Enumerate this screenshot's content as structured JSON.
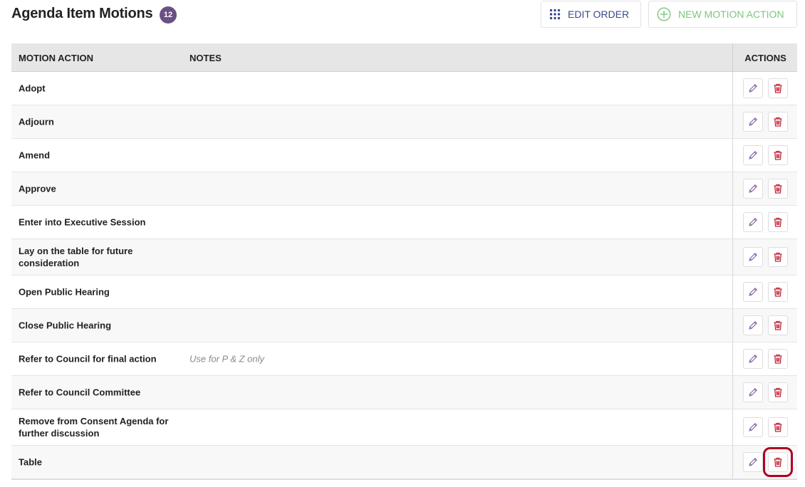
{
  "header": {
    "title": "Agenda Item Motions",
    "count": "12",
    "edit_order_label": "EDIT ORDER",
    "new_motion_label": "NEW MOTION ACTION"
  },
  "table": {
    "columns": {
      "motion_action": "MOTION ACTION",
      "notes": "NOTES",
      "actions": "ACTIONS"
    },
    "rows": [
      {
        "motion": "Adopt",
        "notes": ""
      },
      {
        "motion": "Adjourn",
        "notes": ""
      },
      {
        "motion": "Amend",
        "notes": ""
      },
      {
        "motion": "Approve",
        "notes": ""
      },
      {
        "motion": "Enter into Executive Session",
        "notes": ""
      },
      {
        "motion": "Lay on the table for future consideration",
        "notes": ""
      },
      {
        "motion": "Open Public Hearing",
        "notes": ""
      },
      {
        "motion": "Close Public Hearing",
        "notes": ""
      },
      {
        "motion": "Refer to Council for final action",
        "notes": "Use for P & Z only"
      },
      {
        "motion": "Refer to Council Committee",
        "notes": ""
      },
      {
        "motion": "Remove from Consent Agenda for further discussion",
        "notes": ""
      },
      {
        "motion": "Table",
        "notes": ""
      }
    ]
  },
  "icons": {
    "edit_order": "grid-dots-icon",
    "new_motion": "plus-circle-icon",
    "edit": "pencil-icon",
    "delete": "trash-icon"
  },
  "colors": {
    "badge": "#6b4f86",
    "edit_order_text": "#3a4a8c",
    "new_motion_text": "#7ec57e",
    "pencil": "#8a6aa8",
    "trash": "#c0283a",
    "highlight": "#b00020"
  }
}
